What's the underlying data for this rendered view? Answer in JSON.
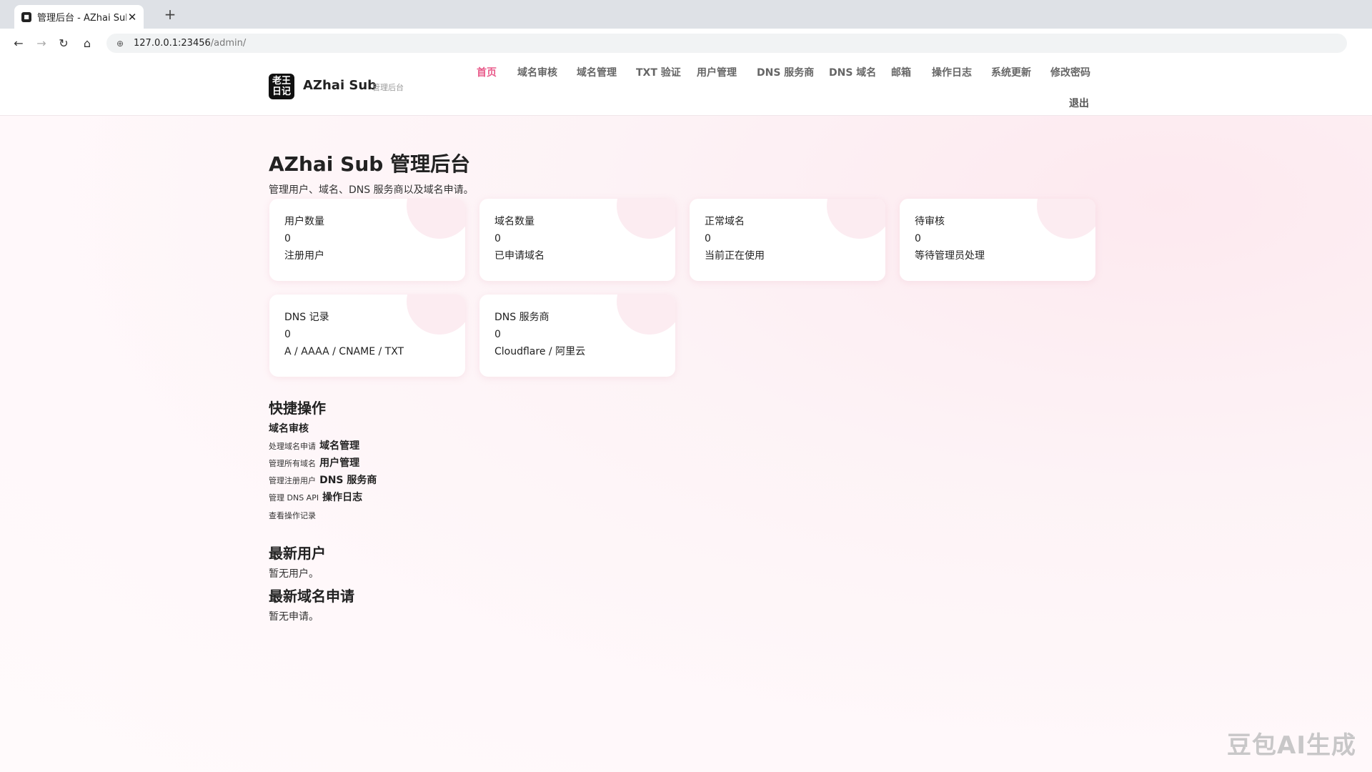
{
  "browser": {
    "tab_title": "管理后台 - AZhai Sub",
    "new_tab": "+",
    "url_host": "127.0.0.1:23456",
    "url_path": "/admin/"
  },
  "header": {
    "logo_text": "老王日记",
    "brand": "AZhai Sub",
    "brand_sub": "管理后台",
    "nav": [
      "首页",
      "域名审核",
      "域名管理",
      "TXT 验证",
      "用户管理",
      "DNS 服务商",
      "DNS 域名",
      "邮箱",
      "操作日志",
      "系统更新",
      "修改密码"
    ],
    "logout": "退出",
    "accent": "#e85a8a"
  },
  "main": {
    "title": "AZhai Sub 管理后台",
    "intro": "管理用户、域名、DNS 服务商以及域名申请。",
    "cards": [
      {
        "label": "用户数量",
        "value": "0",
        "desc": "注册用户"
      },
      {
        "label": "域名数量",
        "value": "0",
        "desc": "已申请域名"
      },
      {
        "label": "正常域名",
        "value": "0",
        "desc": "当前正在使用"
      },
      {
        "label": "待审核",
        "value": "0",
        "desc": "等待管理员处理"
      },
      {
        "label": "DNS 记录",
        "value": "0",
        "desc": "A / AAAA / CNAME / TXT"
      },
      {
        "label": "DNS 服务商",
        "value": "0",
        "desc": "Cloudflare / 阿里云"
      }
    ],
    "quick_title": "快捷操作",
    "quick_actions": [
      {
        "label": "域名审核",
        "desc": "处理域名申请"
      },
      {
        "label": "域名管理",
        "desc": "管理所有域名"
      },
      {
        "label": "用户管理",
        "desc": "管理注册用户"
      },
      {
        "label": "DNS 服务商",
        "desc": "管理 DNS API"
      },
      {
        "label": "操作日志",
        "desc": "查看操作记录"
      }
    ],
    "latest_users_title": "最新用户",
    "latest_users_empty": "暂无用户。",
    "latest_requests_title": "最新域名申请",
    "latest_requests_empty": "暂无申请。"
  },
  "watermark": "豆包AI生成"
}
